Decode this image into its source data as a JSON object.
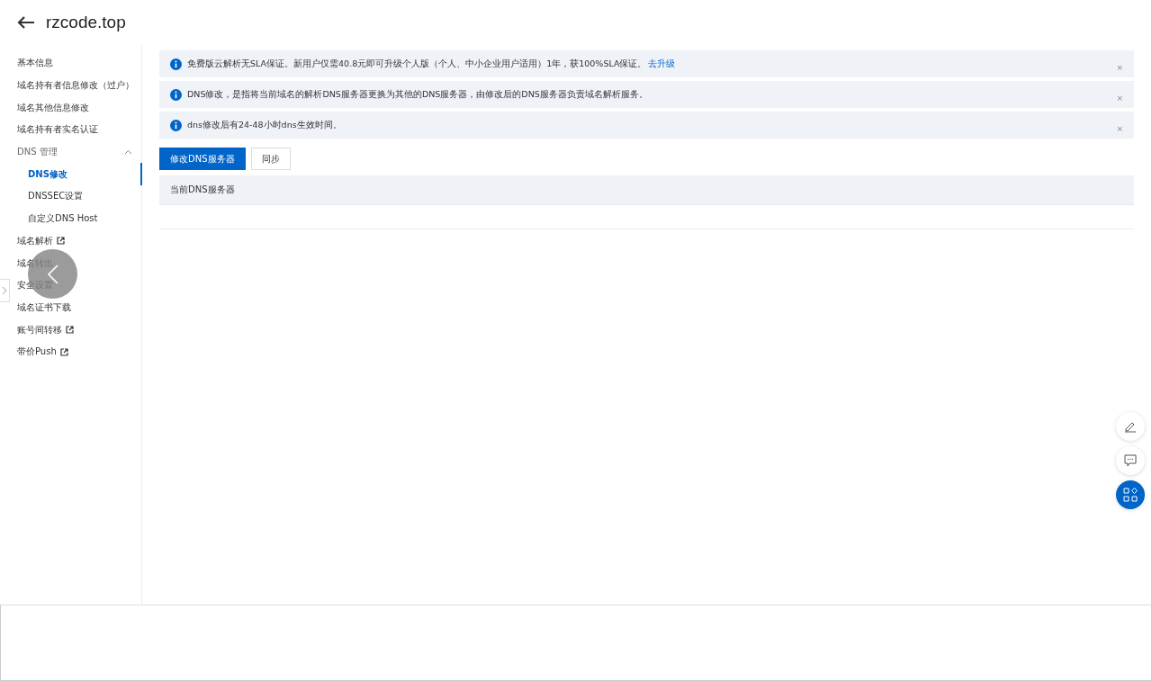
{
  "header": {
    "title": "rzcode.top"
  },
  "sidebar": {
    "items": [
      {
        "label": "基本信息",
        "external": false,
        "selected": false
      },
      {
        "label": "域名持有者信息修改（过户）",
        "external": false,
        "selected": false
      },
      {
        "label": "域名其他信息修改",
        "external": false,
        "selected": false
      },
      {
        "label": "域名持有者实名认证",
        "external": false,
        "selected": false
      },
      {
        "label": "DNS 管理",
        "external": false,
        "selected": false,
        "expanded": true,
        "children": [
          {
            "label": "DNS修改",
            "selected": true
          },
          {
            "label": "DNSSEC设置",
            "selected": false
          },
          {
            "label": "自定义DNS Host",
            "selected": false
          }
        ]
      },
      {
        "label": "域名解析",
        "external": true,
        "selected": false
      },
      {
        "label": "域名转出",
        "external": false,
        "selected": false
      },
      {
        "label": "安全设置",
        "external": false,
        "selected": false
      },
      {
        "label": "域名证书下载",
        "external": false,
        "selected": false
      },
      {
        "label": "账号间转移",
        "external": true,
        "selected": false
      },
      {
        "label": "带价Push",
        "external": true,
        "selected": false
      }
    ]
  },
  "notices": [
    {
      "text": "免费版云解析无SLA保证。新用户仅需40.8元即可升级个人版（个人、中小企业用户适用）1年，获100%SLA保证。",
      "link": "去升级",
      "close": "×"
    },
    {
      "text": "DNS修改，是指将当前域名的解析DNS服务器更换为其他的DNS服务器，由修改后的DNS服务器负责域名解析服务。",
      "close": "×"
    },
    {
      "text": "dns修改后有24-48小时dns生效时间。",
      "close": "×"
    }
  ],
  "buttons": [
    {
      "label": "修改DNS服务器",
      "kind": "primary"
    },
    {
      "label": "同步",
      "kind": "normal"
    }
  ],
  "table": {
    "columns": [
      "当前DNS服务器"
    ]
  }
}
